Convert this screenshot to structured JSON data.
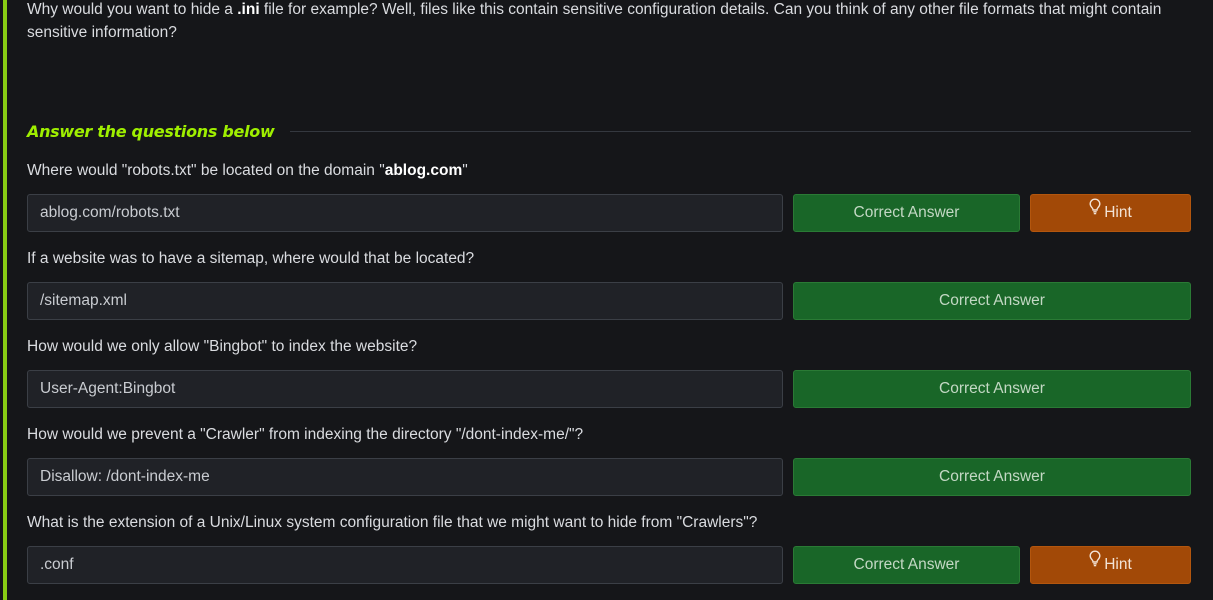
{
  "intro": {
    "text_before": "Why would you want to hide a ",
    "bold": ".ini",
    "text_after": " file for example? Well, files like this contain sensitive configuration details. Can you think of any other file formats that might contain sensitive information?"
  },
  "section": {
    "title": "Answer the questions below"
  },
  "questions": [
    {
      "text_before": "Where would \"robots.txt\" be located on the domain \"",
      "bold": "ablog.com",
      "text_after": "\"",
      "answer": "ablog.com/robots.txt",
      "button": "Correct Answer",
      "hint": "Hint"
    },
    {
      "text": "If a website was to have a sitemap, where would that be located?",
      "answer": "/sitemap.xml",
      "button": "Correct Answer"
    },
    {
      "text": "How would we only allow \"Bingbot\" to index the website?",
      "answer": "User-Agent:Bingbot",
      "button": "Correct Answer"
    },
    {
      "text": "How would we prevent a \"Crawler\" from indexing the directory \"/dont-index-me/\"?",
      "answer": "Disallow: /dont-index-me",
      "button": "Correct Answer"
    },
    {
      "text": "What is the extension of a Unix/Linux system configuration file that we might want to hide from \"Crawlers\"?",
      "answer": ".conf",
      "button": "Correct Answer",
      "hint": "Hint"
    }
  ],
  "colors": {
    "accent": "#88cc14",
    "section_title": "#9fef00",
    "correct_button": "#196628",
    "hint_button": "#a24907",
    "background": "#151619"
  },
  "icons": {
    "hint": "lightbulb-icon"
  }
}
